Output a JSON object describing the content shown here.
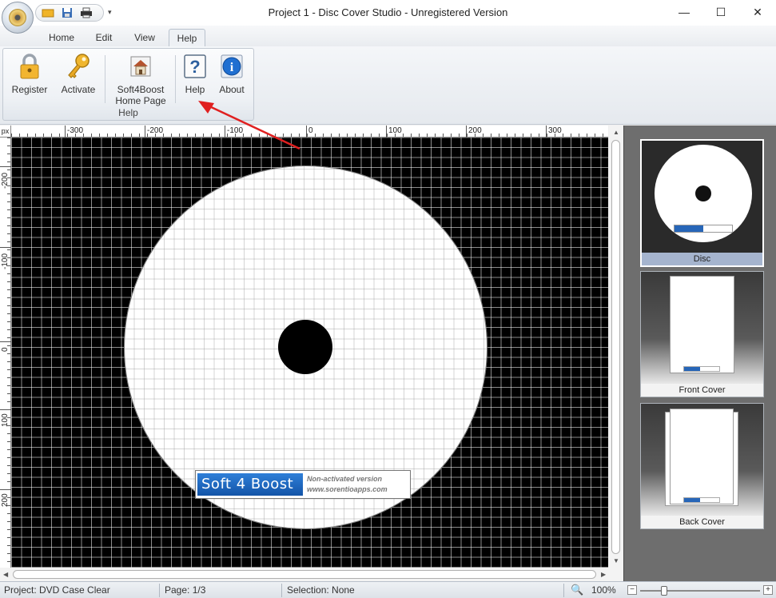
{
  "window": {
    "title": "Project 1 - Disc Cover Studio - Unregistered Version",
    "minimize": "—",
    "maximize": "☐",
    "close": "✕"
  },
  "tabs": [
    {
      "label": "Home"
    },
    {
      "label": "Edit"
    },
    {
      "label": "View"
    },
    {
      "label": "Help"
    }
  ],
  "ribbon": {
    "group_label": "Help",
    "buttons": {
      "register": "Register",
      "activate": "Activate",
      "homepage_line1": "Soft4Boost",
      "homepage_line2": "Home Page",
      "help": "Help",
      "about": "About"
    }
  },
  "ruler": {
    "unit": "px",
    "h_labels": [
      "-300",
      "-200",
      "-100",
      "0",
      "100",
      "200",
      "300"
    ],
    "v_labels": [
      "-200",
      "-100",
      "0",
      "100",
      "200"
    ]
  },
  "watermark": {
    "logo": "Soft 4 Boost",
    "line1": "Non-activated version",
    "line2": "www.sorentioapps.com"
  },
  "pages": [
    {
      "label": "Disc"
    },
    {
      "label": "Front Cover"
    },
    {
      "label": "Back Cover"
    }
  ],
  "status": {
    "project": "Project: DVD Case Clear",
    "page": "Page: 1/3",
    "selection": "Selection: None",
    "zoom": "100%"
  },
  "colors": {
    "canvas_background": "#000000",
    "disc_fill": "#ffffff",
    "annotation_arrow": "#e02020",
    "selected_caption": "#a5b4ce"
  }
}
